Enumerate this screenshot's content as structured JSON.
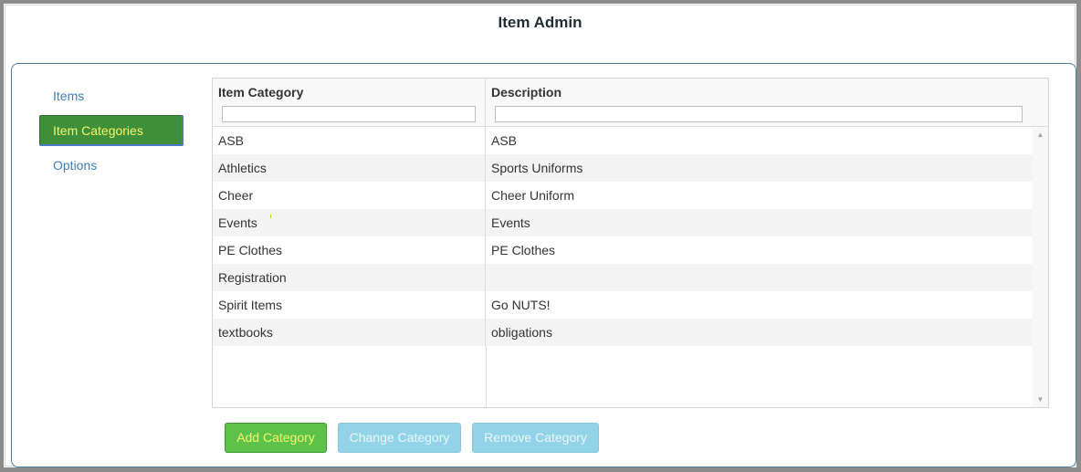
{
  "page": {
    "title": "Item Admin"
  },
  "nav": {
    "items": [
      {
        "label": "Items",
        "active": false
      },
      {
        "label": "Item Categories",
        "active": true
      },
      {
        "label": "Options",
        "active": false
      }
    ]
  },
  "grid": {
    "columns": [
      {
        "label": "Item Category",
        "filter_value": ""
      },
      {
        "label": "Description",
        "filter_value": ""
      }
    ],
    "rows": [
      {
        "category": "ASB",
        "description": "ASB"
      },
      {
        "category": "Athletics",
        "description": "Sports Uniforms"
      },
      {
        "category": "Cheer",
        "description": "Cheer Uniform"
      },
      {
        "category": "Events",
        "description": "Events"
      },
      {
        "category": "PE Clothes",
        "description": "PE Clothes"
      },
      {
        "category": "Registration",
        "description": ""
      },
      {
        "category": "Spirit Items",
        "description": "Go NUTS!"
      },
      {
        "category": "textbooks",
        "description": "obligations"
      }
    ]
  },
  "buttons": {
    "add": {
      "label": "Add Category",
      "enabled": true
    },
    "change": {
      "label": "Change Category",
      "enabled": false
    },
    "remove": {
      "label": "Remove Category",
      "enabled": false
    }
  },
  "icons": {
    "scroll_up": "arrow-up-icon",
    "scroll_down": "arrow-down-icon"
  },
  "colors": {
    "accent_green": "#3f8f3a",
    "accent_text_yellow": "#f3f66a",
    "link_blue": "#3d7fb6",
    "disabled_button": "#92d3e8",
    "panel_border": "#4d7ea6"
  }
}
